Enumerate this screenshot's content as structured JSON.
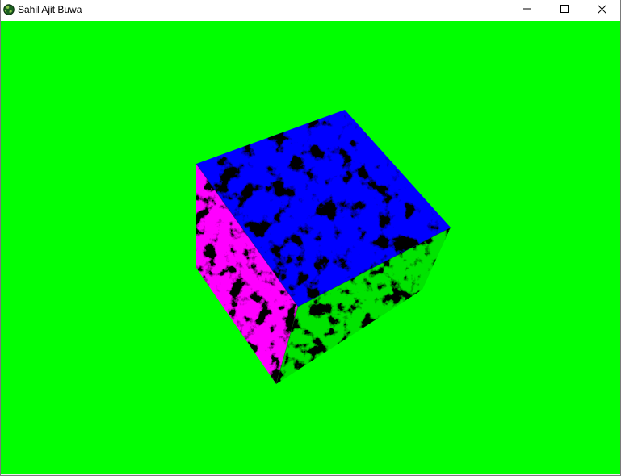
{
  "window": {
    "title": "Sahil Ajit Buwa",
    "icon": "globe-icon",
    "controls": [
      "minimize-icon",
      "maximize-icon",
      "close-icon"
    ]
  },
  "scene": {
    "clear_color": "#00ff00",
    "object": "textured-cube",
    "texture": "marble",
    "faces": {
      "top": "#0000ff",
      "left": "#ff00ff",
      "right": "#00ff00"
    }
  }
}
